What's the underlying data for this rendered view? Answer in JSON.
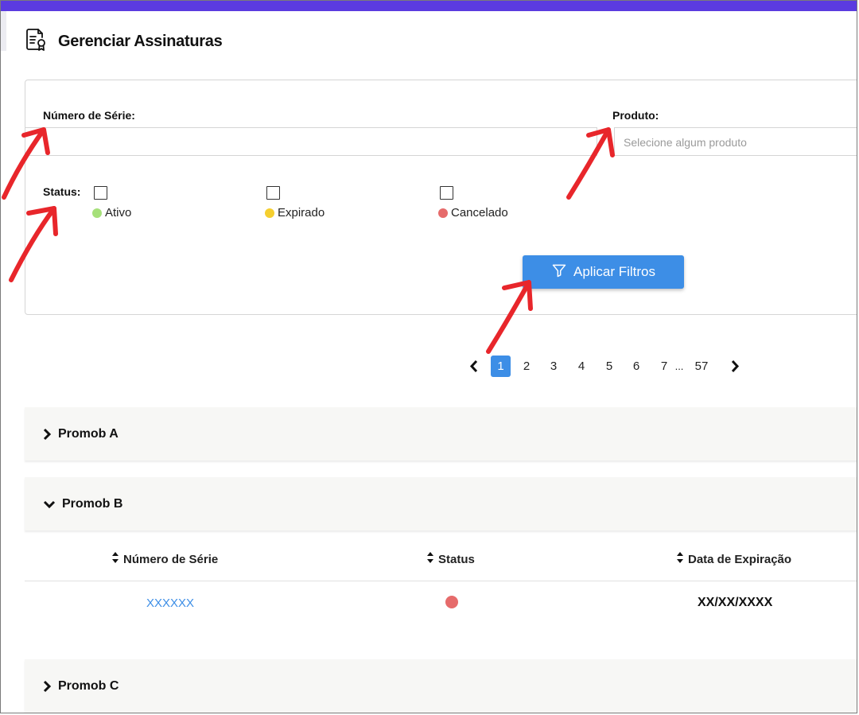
{
  "header": {
    "title": "Gerenciar Assinaturas",
    "icon": "certificate-document-icon"
  },
  "filters": {
    "serial_label": "Número de Série:",
    "serial_value": "",
    "product_label": "Produto:",
    "product_placeholder": "Selecione algum produto",
    "status_label": "Status:",
    "statuses": [
      {
        "label": "Ativo",
        "color": "#a6e07a",
        "checked": false
      },
      {
        "label": "Expirado",
        "color": "#f5cf2f",
        "checked": false
      },
      {
        "label": "Cancelado",
        "color": "#e66b6b",
        "checked": false
      }
    ],
    "apply_label": "Aplicar Filtros"
  },
  "pagination": {
    "pages": [
      "1",
      "2",
      "3",
      "4",
      "5",
      "6",
      "7"
    ],
    "ellipsis": "...",
    "last": "57",
    "current": "1"
  },
  "groups": [
    {
      "name": "Promob A",
      "expanded": false
    },
    {
      "name": "Promob B",
      "expanded": true
    },
    {
      "name": "Promob C",
      "expanded": false
    }
  ],
  "table": {
    "columns": [
      "Número de Série",
      "Status",
      "Data de Expiração"
    ],
    "rows": [
      {
        "serial": "XXXXXX",
        "status_color": "#e66b6b",
        "expiration": "XX/XX/XXXX"
      }
    ]
  },
  "colors": {
    "accent": "#3d8ee6",
    "topbar": "#5b3be0",
    "annotation": "#e8262b"
  }
}
